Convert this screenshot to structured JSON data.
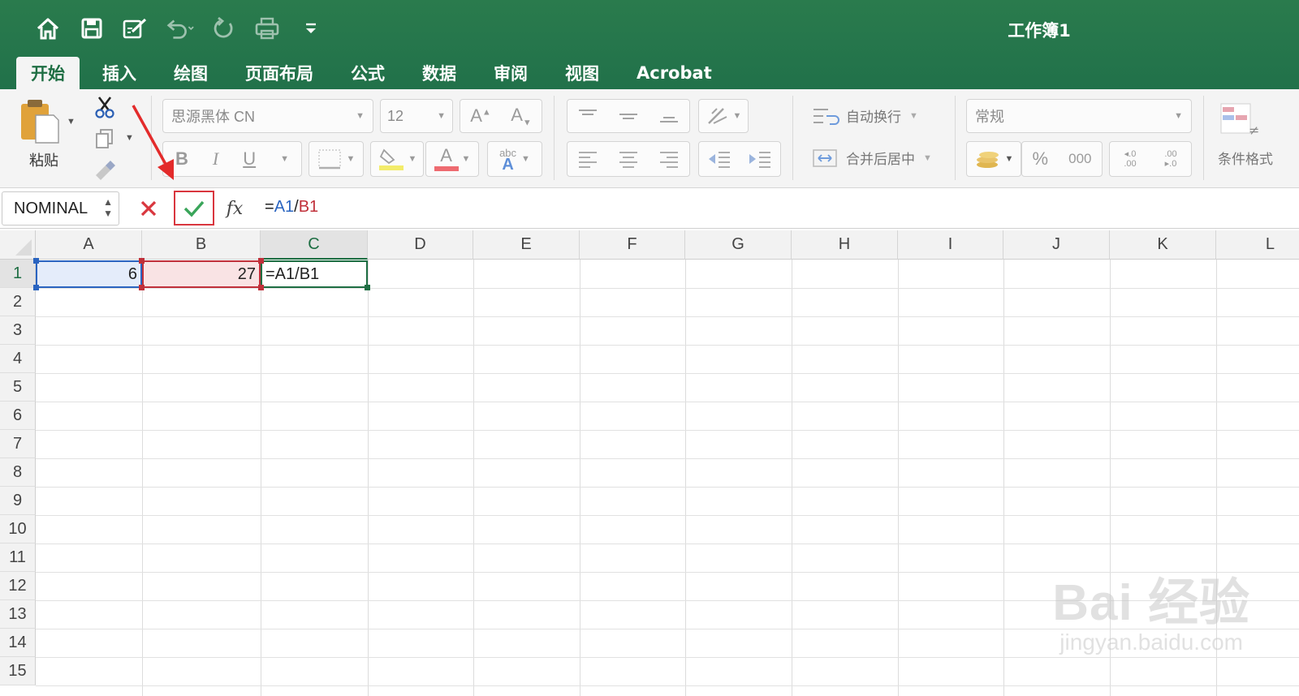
{
  "window": {
    "title": "工作簿1"
  },
  "qat": {
    "icons": [
      "home-icon",
      "save-icon",
      "edit-icon",
      "undo-icon",
      "redo-icon",
      "print-icon",
      "customize-icon"
    ]
  },
  "tabs": [
    {
      "label": "开始",
      "active": true
    },
    {
      "label": "插入"
    },
    {
      "label": "绘图"
    },
    {
      "label": "页面布局"
    },
    {
      "label": "公式"
    },
    {
      "label": "数据"
    },
    {
      "label": "审阅"
    },
    {
      "label": "视图"
    },
    {
      "label": "Acrobat"
    }
  ],
  "ribbon": {
    "paste_label": "粘贴",
    "font_name": "思源黑体 CN",
    "font_size": "12",
    "bold": "B",
    "italic": "I",
    "underline": "U",
    "font_color_glyph": "A",
    "abc_glyph": "abc",
    "wrap_text": "自动换行",
    "merge_center": "合并后居中",
    "number_format": "常规",
    "percent": "%",
    "thousands": "000",
    "conditional_format": "条件格式"
  },
  "formula_bar": {
    "name_box": "NOMINAL",
    "fx": "fx",
    "formula_prefix": "=",
    "ref1": "A1",
    "slash": "/",
    "ref2": "B1"
  },
  "sheet": {
    "columns": [
      "A",
      "B",
      "C",
      "D",
      "E",
      "F",
      "G",
      "H",
      "I",
      "J",
      "K",
      "L"
    ],
    "rows": [
      "1",
      "2",
      "3",
      "4",
      "5",
      "6",
      "7",
      "8",
      "9",
      "10",
      "11",
      "12",
      "13",
      "14",
      "15"
    ],
    "cells": {
      "A1": "6",
      "B1": "27",
      "C1": "=A1/B1"
    },
    "selected_column": "C",
    "selected_row": "1"
  },
  "watermark": {
    "main": "Bai 经验",
    "url": "jingyan.baidu.com"
  },
  "colors": {
    "excel_green": "#217346",
    "ref_blue": "#2a64c0",
    "ref_red": "#c0303a",
    "highlight_red": "#d9363e"
  }
}
